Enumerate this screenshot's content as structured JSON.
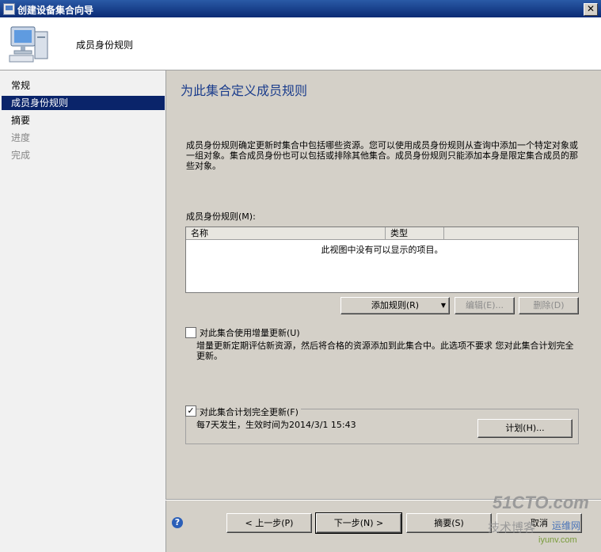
{
  "window": {
    "title": "创建设备集合向导",
    "close_glyph": "✕"
  },
  "header": {
    "label": "成员身份规则",
    "icon": "computer-icon"
  },
  "nav": {
    "items": [
      {
        "label": "常规"
      },
      {
        "label": "成员身份规则"
      },
      {
        "label": "摘要"
      },
      {
        "label": "进度"
      },
      {
        "label": "完成"
      }
    ]
  },
  "main": {
    "heading": "为此集合定义成员规则",
    "description": "成员身份规则确定更新时集合中包括哪些资源。您可以使用成员身份规则从查询中添加一个特定对象或一组对象。集合成员身份也可以包括或排除其他集合。成员身份规则只能添加本身是限定集合成员的那些对象。",
    "members_label": "成员身份规则(M):",
    "table": {
      "columns": [
        "名称",
        "类型",
        ""
      ],
      "empty_text": "此视图中没有可以显示的项目。"
    },
    "buttons": {
      "add_rule": "添加规则(R)",
      "add_rule_arrow": "▼",
      "edit": "编辑(E)...",
      "delete": "删除(D)"
    },
    "incremental": {
      "checked": false,
      "label": "对此集合使用增量更新(U)",
      "description": "增量更新定期评估新资源，然后将合格的资源添加到此集合中。此选项不要求  您对此集合计划完全更新。"
    },
    "full_update": {
      "checked": true,
      "check_glyph": "✓",
      "label": "对此集合计划完全更新(F)",
      "schedule": "每7天发生，生效时间为2014/3/1 15:43",
      "schedule_button": "计划(H)..."
    }
  },
  "footer": {
    "help_glyph": "?",
    "prev": "< 上一步(P)",
    "next": "下一步(N) >",
    "summary": "摘要(S)",
    "cancel": "取消"
  },
  "watermark": {
    "line1": "51CTO.com",
    "line2": "技术博客",
    "line3": "运维网",
    "line4": "iyunv.com"
  },
  "colors": {
    "title_bar": "#0a246a",
    "selection": "#0a246a",
    "heading": "#1a3c8c"
  }
}
